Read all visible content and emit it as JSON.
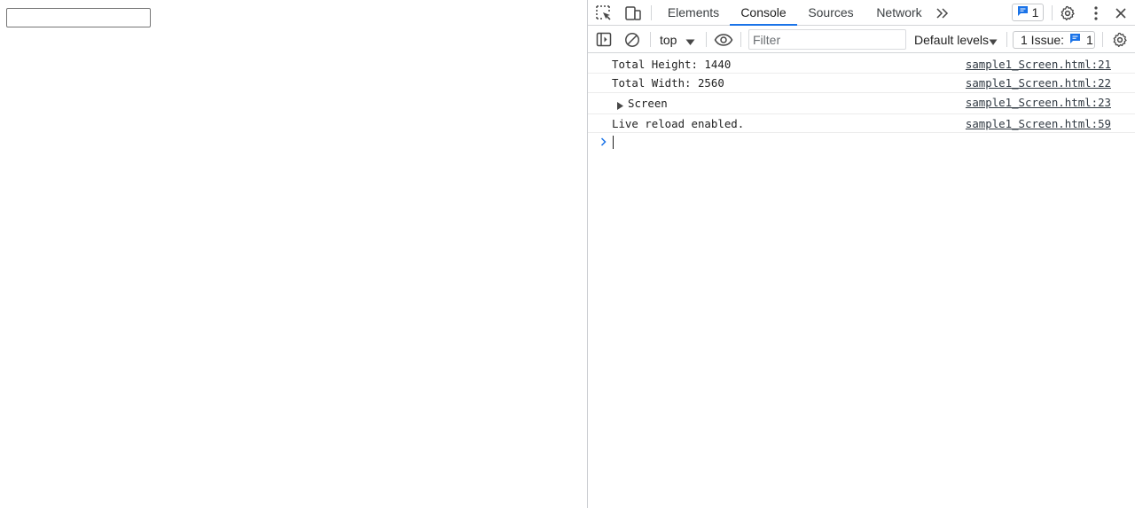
{
  "page": {
    "input_value": ""
  },
  "devtools": {
    "tabs": [
      {
        "label": "Elements",
        "active": false
      },
      {
        "label": "Console",
        "active": true
      },
      {
        "label": "Sources",
        "active": false
      },
      {
        "label": "Network",
        "active": false
      }
    ],
    "messages_badge_count": "1",
    "toolbar": {
      "context": "top",
      "filter_placeholder": "Filter",
      "levels": "Default levels",
      "issues_label": "1 Issue:",
      "issues_count": "1"
    },
    "console": {
      "rows": [
        {
          "message": "Total Height: 1440",
          "source": "sample1_Screen.html:21"
        },
        {
          "message": "Total Width: 2560",
          "source": "sample1_Screen.html:22"
        },
        {
          "message": "Screen",
          "source": "sample1_Screen.html:23",
          "expandable": true
        },
        {
          "message": "Live reload enabled.",
          "source": "sample1_Screen.html:59"
        }
      ]
    },
    "colors": {
      "accent": "#1a73e8",
      "border": "#d3d5d8"
    },
    "icons": [
      "inspect-element-icon",
      "device-toolbar-icon",
      "more-tabs-icon",
      "message-icon",
      "settings-icon",
      "more-options-icon",
      "close-icon",
      "sidebar-toggle-icon",
      "clear-console-icon",
      "dropdown-arrow-icon",
      "live-expression-eye-icon",
      "console-settings-icon",
      "expand-triangle-icon",
      "prompt-chevron-icon"
    ]
  }
}
